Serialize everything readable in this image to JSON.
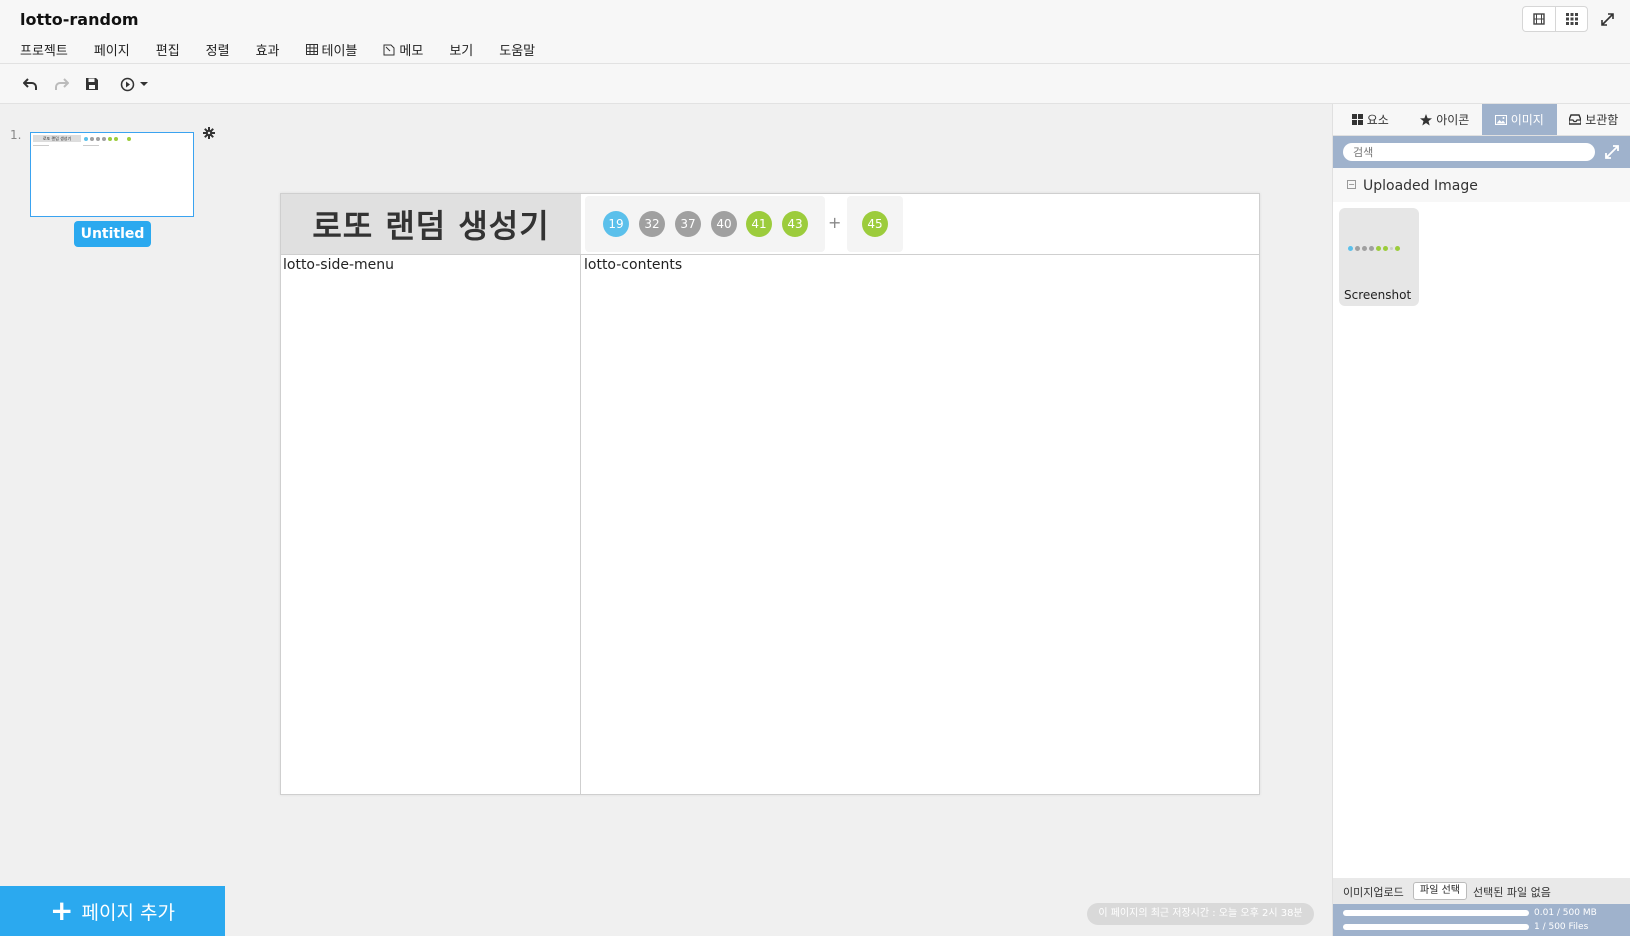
{
  "app": {
    "title": "lotto-random"
  },
  "menu": [
    {
      "label": "프로젝트",
      "icon": ""
    },
    {
      "label": "페이지",
      "icon": ""
    },
    {
      "label": "편집",
      "icon": ""
    },
    {
      "label": "정렬",
      "icon": ""
    },
    {
      "label": "효과",
      "icon": ""
    },
    {
      "label": "테이블",
      "icon": "table-icon"
    },
    {
      "label": "메모",
      "icon": "memo-icon"
    },
    {
      "label": "보기",
      "icon": ""
    },
    {
      "label": "도움말",
      "icon": ""
    }
  ],
  "pages": {
    "number": "1.",
    "label": "Untitled",
    "add_label": "페이지 추가"
  },
  "canvas": {
    "title": "로또 랜덤 생성기",
    "balls": [
      {
        "value": "19",
        "color": "#5bc0eb"
      },
      {
        "value": "32",
        "color": "#a0a0a0"
      },
      {
        "value": "37",
        "color": "#a0a0a0"
      },
      {
        "value": "40",
        "color": "#a0a0a0"
      },
      {
        "value": "41",
        "color": "#9ccc3c"
      },
      {
        "value": "43",
        "color": "#9ccc3c"
      }
    ],
    "plus": "+",
    "bonus": {
      "value": "45",
      "color": "#9ccc3c"
    },
    "side_menu_label": "lotto-side-menu",
    "contents_label": "lotto-contents"
  },
  "status": {
    "save_text": "이 페이지의 최근 저장시간 : 오늘 오후 2시 38분"
  },
  "right_panel": {
    "tabs": [
      {
        "label": "요소",
        "icon": "grid-icon",
        "active": false
      },
      {
        "label": "아이콘",
        "icon": "star-icon",
        "active": false
      },
      {
        "label": "이미지",
        "icon": "image-icon",
        "active": true
      },
      {
        "label": "보관함",
        "icon": "inbox-icon",
        "active": false
      }
    ],
    "search": {
      "placeholder": "검색"
    },
    "section_title": "Uploaded Image",
    "image_caption": "Screenshot",
    "upload_label": "이미지업로드",
    "file_button": "파일 선택",
    "no_file": "선택된 파일 없음",
    "storage": "0.01 / 500 MB",
    "storage_fraction": 2e-05,
    "files": "1 / 500 Files",
    "files_fraction": 0.002
  },
  "colors": {
    "accent": "#2ba9ef",
    "panel": "#9fb2cc"
  }
}
